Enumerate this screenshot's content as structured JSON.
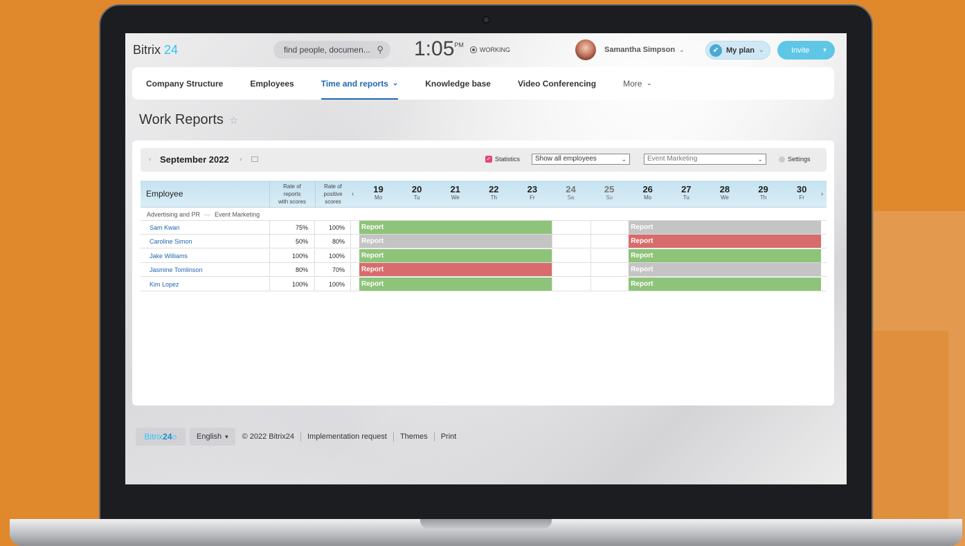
{
  "header": {
    "logo_text": "Bitrix",
    "logo_num": "24",
    "search_placeholder": "find people, documen...",
    "clock_time": "1:05",
    "clock_ampm": "PM",
    "status": "WORKING",
    "user_name": "Samantha Simpson",
    "my_plan": "My plan",
    "invite": "Invite"
  },
  "nav": {
    "items": [
      "Company Structure",
      "Employees",
      "Time and reports",
      "Knowledge base",
      "Video Conferencing",
      "More"
    ],
    "active": "Time and reports"
  },
  "page_title": "Work Reports",
  "toolbar": {
    "month": "September 2022",
    "statistics_label": "Statistics",
    "statistics_checked": true,
    "employees_filter": "Show all employees",
    "department_filter": "Event Marketing",
    "settings_label": "Settings"
  },
  "table": {
    "employee_header": "Employee",
    "col_rate_scores_lines": [
      "Rate of",
      "reports",
      "with scores"
    ],
    "col_rate_positive_lines": [
      "Rate of",
      "positive",
      "scores"
    ],
    "days": [
      {
        "num": "19",
        "dow": "Mo",
        "weekend": false
      },
      {
        "num": "20",
        "dow": "Tu",
        "weekend": false
      },
      {
        "num": "21",
        "dow": "We",
        "weekend": false
      },
      {
        "num": "22",
        "dow": "Th",
        "weekend": false
      },
      {
        "num": "23",
        "dow": "Fr",
        "weekend": false
      },
      {
        "num": "24",
        "dow": "Sa",
        "weekend": true
      },
      {
        "num": "25",
        "dow": "Su",
        "weekend": true
      },
      {
        "num": "26",
        "dow": "Mo",
        "weekend": false
      },
      {
        "num": "27",
        "dow": "Tu",
        "weekend": false
      },
      {
        "num": "28",
        "dow": "We",
        "weekend": false
      },
      {
        "num": "29",
        "dow": "Th",
        "weekend": false
      },
      {
        "num": "30",
        "dow": "Fr",
        "weekend": false
      }
    ],
    "group_department": "Advertising and PR",
    "group_team": "Event Marketing",
    "rows": [
      {
        "name": "Sam Kwan",
        "rate_scores": "75%",
        "rate_positive": "100%",
        "week1": {
          "label": "Report",
          "status": "green"
        },
        "week2": {
          "label": "Report",
          "status": "gray"
        }
      },
      {
        "name": "Caroline Simon",
        "rate_scores": "50%",
        "rate_positive": "80%",
        "week1": {
          "label": "Report",
          "status": "gray"
        },
        "week2": {
          "label": "Report",
          "status": "red"
        }
      },
      {
        "name": "Jake Williams",
        "rate_scores": "100%",
        "rate_positive": "100%",
        "week1": {
          "label": "Report",
          "status": "green"
        },
        "week2": {
          "label": "Report",
          "status": "green"
        }
      },
      {
        "name": "Jasmine Tomlinson",
        "rate_scores": "80%",
        "rate_positive": "70%",
        "week1": {
          "label": "Report",
          "status": "red"
        },
        "week2": {
          "label": "Report",
          "status": "gray"
        }
      },
      {
        "name": "Kim Lopez",
        "rate_scores": "100%",
        "rate_positive": "100%",
        "week1": {
          "label": "Report",
          "status": "green"
        },
        "week2": {
          "label": "Report",
          "status": "green"
        }
      }
    ]
  },
  "footer": {
    "logo_text": "Bitrix",
    "logo_num": "24",
    "language": "English",
    "copyright": "© 2022 Bitrix24",
    "links": [
      "Implementation request",
      "Themes",
      "Print"
    ]
  },
  "colors": {
    "accent": "#2067b0",
    "brand": "#2fc6f6",
    "status_green": "#8ec47a",
    "status_gray": "#c4c4c4",
    "status_red": "#d86b6b",
    "background": "#e0882c"
  }
}
